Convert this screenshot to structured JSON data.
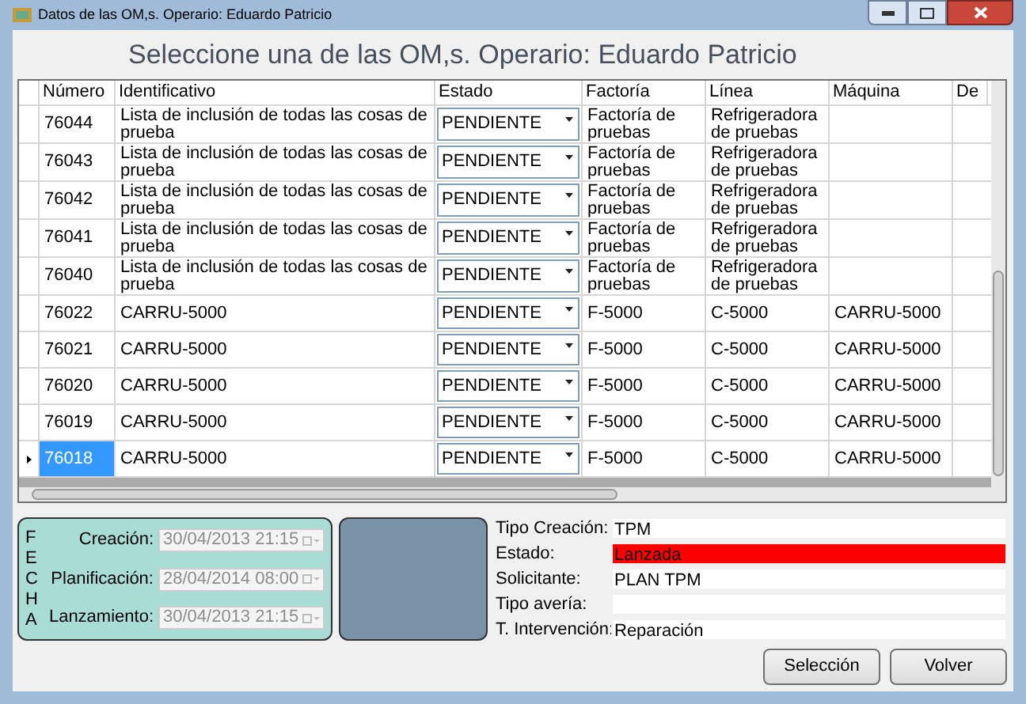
{
  "window": {
    "title": "Datos de las OM,s. Operario: Eduardo Patricio"
  },
  "heading": "Seleccione una de las OM,s. Operario: Eduardo Patricio",
  "table": {
    "columns": [
      "Número",
      "Identificativo",
      "Estado",
      "Factoría",
      "Línea",
      "Máquina",
      "De"
    ],
    "rows": [
      {
        "selected": false,
        "cells": [
          "76044",
          "Lista de inclusión de todas las cosas de prueba",
          "PENDIENTE",
          "Factoría de pruebas",
          "Refrigeradora de pruebas",
          ""
        ]
      },
      {
        "selected": false,
        "cells": [
          "76043",
          "Lista de inclusión de todas las cosas de prueba",
          "PENDIENTE",
          "Factoría de pruebas",
          "Refrigeradora de pruebas",
          ""
        ]
      },
      {
        "selected": false,
        "cells": [
          "76042",
          "Lista de inclusión de todas las cosas de prueba",
          "PENDIENTE",
          "Factoría de pruebas",
          "Refrigeradora de pruebas",
          ""
        ]
      },
      {
        "selected": false,
        "cells": [
          "76041",
          "Lista de inclusión de todas las cosas de prueba",
          "PENDIENTE",
          "Factoría de pruebas",
          "Refrigeradora de pruebas",
          ""
        ]
      },
      {
        "selected": false,
        "cells": [
          "76040",
          "Lista de inclusión de todas las cosas de prueba",
          "PENDIENTE",
          "Factoría de pruebas",
          "Refrigeradora de pruebas",
          ""
        ]
      },
      {
        "selected": false,
        "cells": [
          "76022",
          "CARRU-5000",
          "PENDIENTE",
          "F-5000",
          "C-5000",
          "CARRU-5000"
        ]
      },
      {
        "selected": false,
        "cells": [
          "76021",
          "CARRU-5000",
          "PENDIENTE",
          "F-5000",
          "C-5000",
          "CARRU-5000"
        ]
      },
      {
        "selected": false,
        "cells": [
          "76020",
          "CARRU-5000",
          "PENDIENTE",
          "F-5000",
          "C-5000",
          "CARRU-5000"
        ]
      },
      {
        "selected": false,
        "cells": [
          "76019",
          "CARRU-5000",
          "PENDIENTE",
          "F-5000",
          "C-5000",
          "CARRU-5000"
        ]
      },
      {
        "selected": true,
        "cells": [
          "76018",
          "CARRU-5000",
          "PENDIENTE",
          "F-5000",
          "C-5000",
          "CARRU-5000"
        ]
      }
    ]
  },
  "fecha": {
    "title": "FECHA",
    "dates": [
      {
        "label": "Creación:",
        "value": "30/04/2013 21:15",
        "disabled": true
      },
      {
        "label": "Planificación:",
        "value": "28/04/2014 08:00",
        "disabled": true
      },
      {
        "label": "Lanzamiento:",
        "value": "30/04/2013 21:15",
        "disabled": true
      }
    ]
  },
  "details": [
    {
      "label": "Tipo Creación:",
      "value": "TPM"
    },
    {
      "label": "Estado:",
      "value": "Lanzada",
      "color": "#ff0000"
    },
    {
      "label": "Solicitante:",
      "value": "PLAN TPM"
    },
    {
      "label": "Tipo avería:"
    },
    {
      "label": "T. Intervención:",
      "value": "Reparación"
    }
  ],
  "buttons": [
    "Selección",
    "Volver"
  ]
}
